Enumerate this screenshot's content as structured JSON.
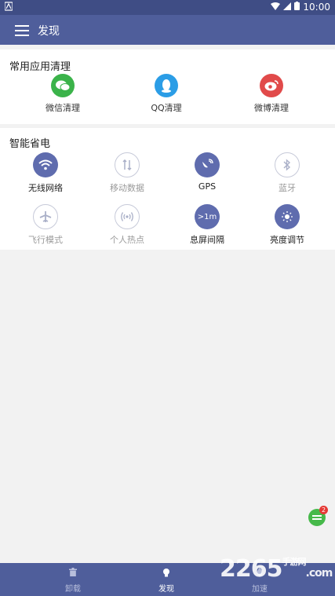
{
  "status": {
    "time": "10:00",
    "left_icon": "android-notification-icon"
  },
  "header": {
    "title": "发现"
  },
  "common_cleanup": {
    "title": "常用应用清理",
    "apps": [
      {
        "label": "微信清理",
        "icon": "wechat-icon",
        "color": "#3bb34a"
      },
      {
        "label": "QQ清理",
        "icon": "qq-icon",
        "color": "#2b9de6"
      },
      {
        "label": "微博清理",
        "icon": "weibo-icon",
        "color": "#e14a4a"
      }
    ]
  },
  "power_saving": {
    "title": "智能省电",
    "items": [
      {
        "label": "无线网络",
        "icon": "wifi-icon",
        "state": "on"
      },
      {
        "label": "移动数据",
        "icon": "mobile-data-icon",
        "state": "off"
      },
      {
        "label": "GPS",
        "icon": "gps-icon",
        "state": "on"
      },
      {
        "label": "蓝牙",
        "icon": "bluetooth-icon",
        "state": "off"
      },
      {
        "label": "飞行模式",
        "icon": "airplane-icon",
        "state": "off"
      },
      {
        "label": "个人热点",
        "icon": "hotspot-icon",
        "state": "off"
      },
      {
        "label": "息屏间隔",
        "icon": "screen-timeout-icon",
        "state": "on",
        "icon_text": ">1m"
      },
      {
        "label": "亮度调节",
        "icon": "brightness-icon",
        "state": "on"
      }
    ]
  },
  "fab": {
    "badge": "2"
  },
  "bottom_nav": [
    {
      "label": "卸载",
      "icon": "trash-icon"
    },
    {
      "label": "发现",
      "icon": "lightbulb-icon"
    },
    {
      "label": "加速",
      "icon": "rocket-icon"
    }
  ],
  "watermark": {
    "text": "2265",
    "suffix": ".com",
    "sub": "手游网"
  }
}
